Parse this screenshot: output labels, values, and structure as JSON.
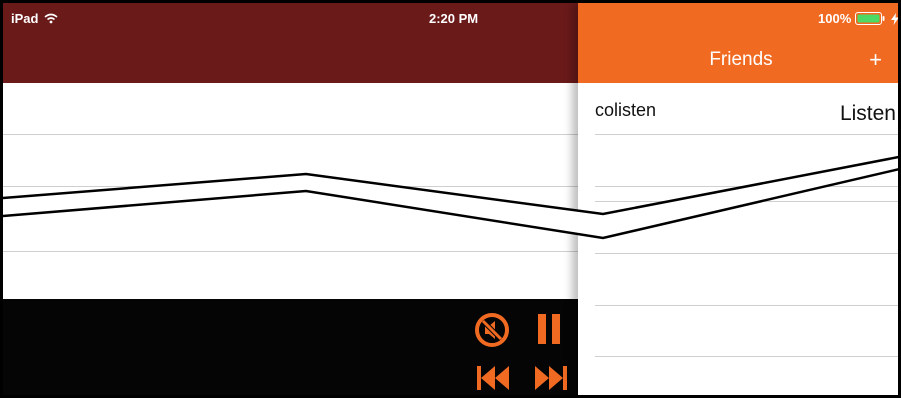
{
  "status_bar": {
    "device": "iPad",
    "time": "2:20 PM",
    "battery": "100%",
    "icons": [
      "wifi-icon",
      "battery-icon",
      "charging-bolt-icon"
    ]
  },
  "colors": {
    "main_header": "#6b1a1a",
    "friends_header": "#f06a22",
    "player_bg": "#050505",
    "accent": "#f06a22"
  },
  "friends": {
    "title": "Friends",
    "add_label": "+",
    "items": [
      {
        "name": "colisten",
        "action": "Listen"
      }
    ]
  },
  "player": {
    "controls": [
      "mute-icon",
      "pause-icon",
      "rewind-icon",
      "fast-forward-icon"
    ]
  }
}
